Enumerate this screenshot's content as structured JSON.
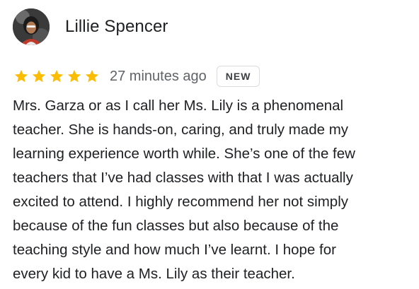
{
  "reviewer": {
    "name": "Lillie Spencer",
    "avatar_icon": "profile-photo"
  },
  "rating": {
    "stars": 5,
    "max": 5,
    "star_color": "#fbbc04",
    "star_icon": "star-icon"
  },
  "timestamp": "27 minutes ago",
  "badge": "NEW",
  "review_text": "Mrs. Garza or as I call her Ms. Lily is a phenomenal\nteacher. She is hands-on, caring, and truly made my\nlearning experience worth while. She’s one of the few\nteachers that I’ve had classes with that I was actually\nexcited to attend. I highly recommend her not simply\nbecause of the fun classes but also because of the\nteaching style and how much I’ve learnt. I hope for\nevery kid to have a Ms. Lily as their teacher."
}
